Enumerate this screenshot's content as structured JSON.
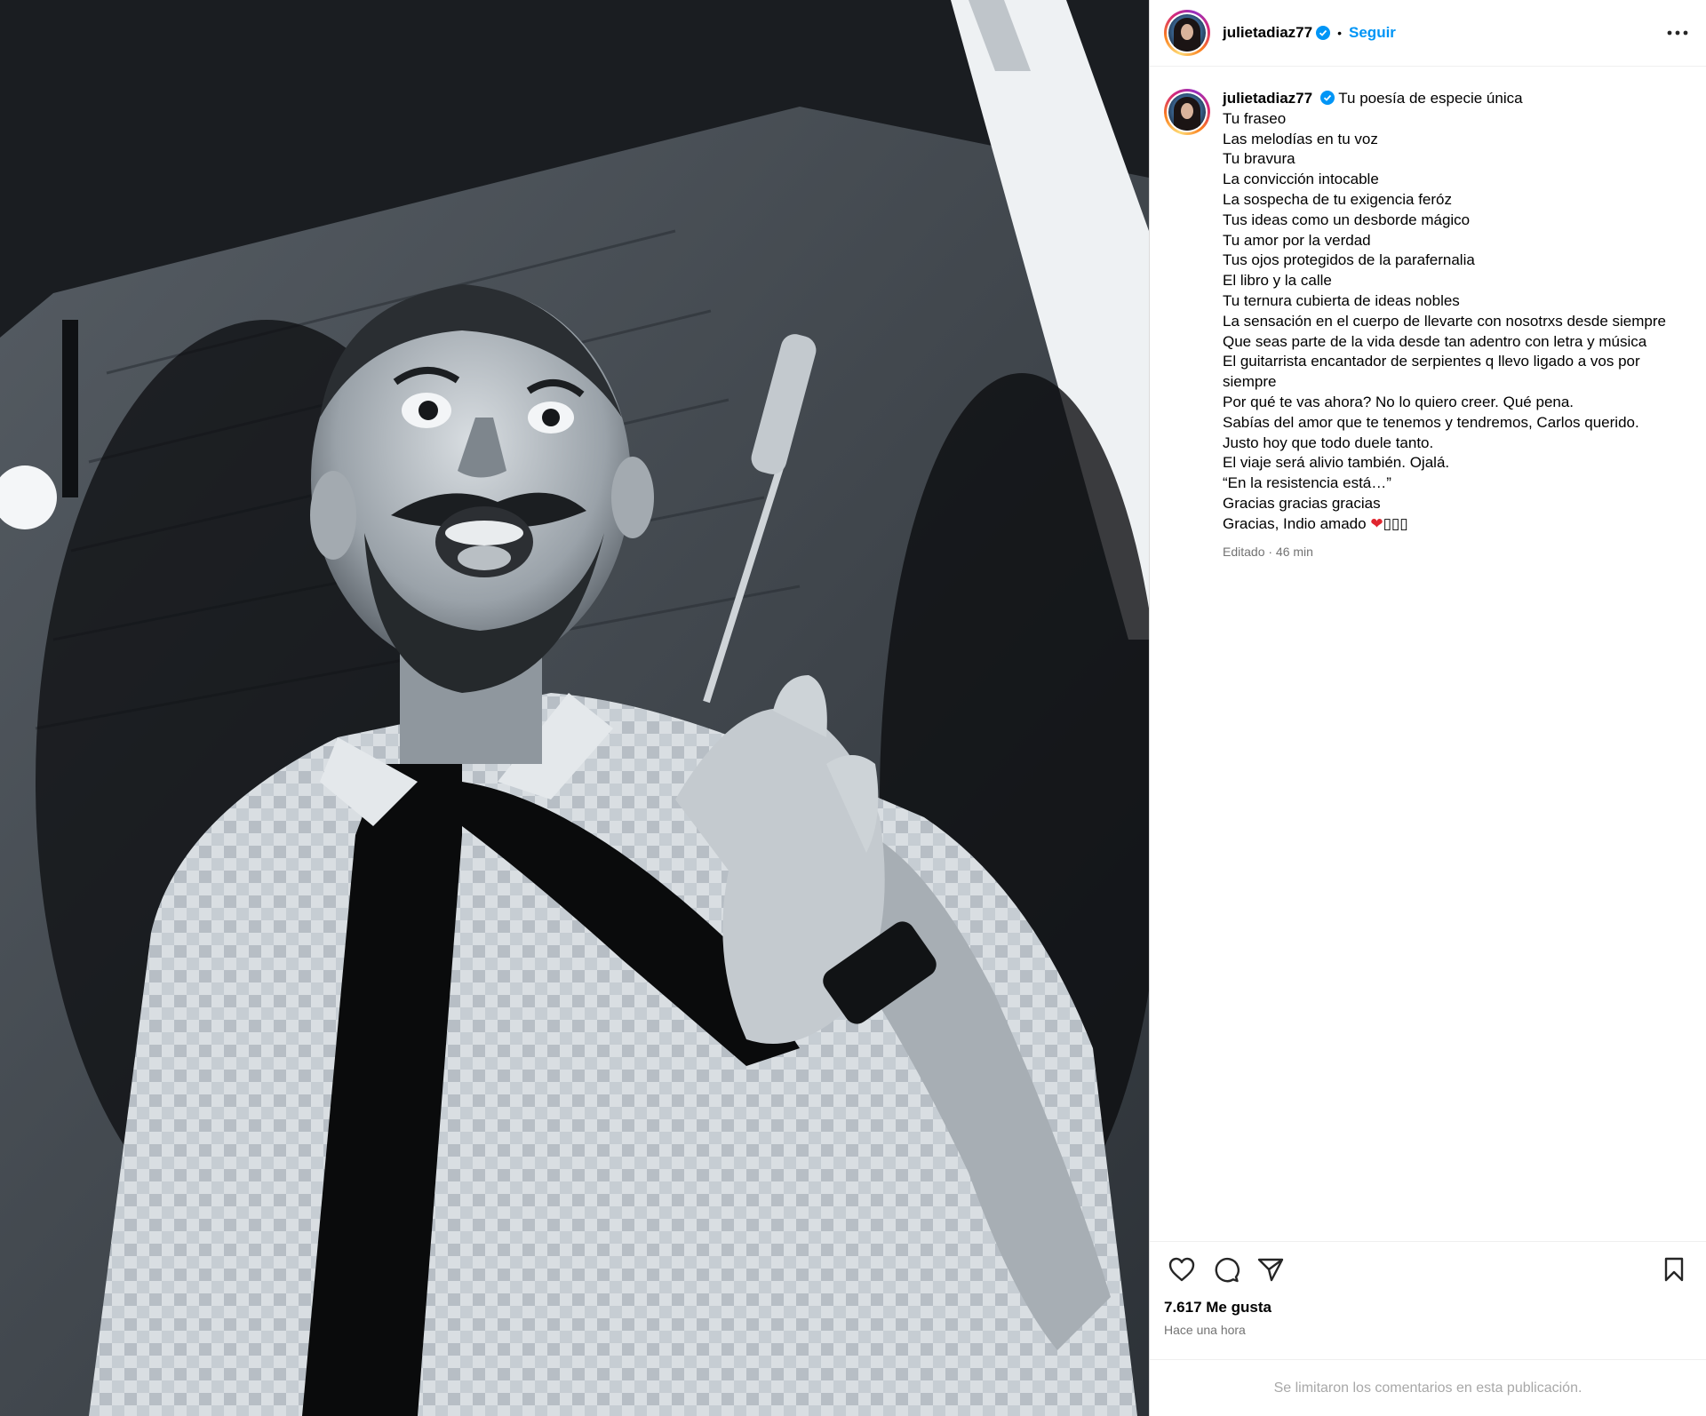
{
  "post": {
    "username": "julietadiaz77",
    "follow_label": "Seguir",
    "separator": "•",
    "caption_first": "Tu poesía de especie única",
    "caption_lines": [
      "Tu fraseo",
      "Las melodías en tu voz",
      "Tu bravura",
      "La convicción intocable",
      "La sospecha de tu exigencia feróz",
      "Tus ideas como un desborde mágico",
      "Tu amor por la verdad",
      "Tus ojos protegidos de la parafernalia",
      "El libro y la calle",
      "Tu ternura cubierta de ideas nobles",
      "La sensación en el cuerpo de llevarte con nosotrxs desde siempre",
      "Que seas parte de la vida desde tan adentro con letra y música",
      "El guitarrista encantador de serpientes q llevo ligado a vos por siempre",
      "Por qué te vas ahora? No lo quiero creer. Qué pena.",
      "Sabías del amor que te tenemos y tendremos, Carlos querido.",
      "Justo hoy que todo duele tanto.",
      "El viaje será alivio también. Ojalá.",
      "“En la resistencia está…”",
      "Gracias gracias gracias"
    ],
    "caption_last": "Gracias, Indio amado",
    "caption_emoji": "❤",
    "caption_emoji_tail": "▯▯▯",
    "edited_meta": "Editado · 46 min",
    "likes": "7.617 Me gusta",
    "time_ago": "Hace una hora",
    "comments_notice": "Se limitaron los comentarios en esta publicación."
  },
  "icons": {
    "more": "more-options-icon",
    "like": "heart-icon",
    "comment": "comment-icon",
    "share": "send-icon",
    "save": "bookmark-icon",
    "verified": "verified-badge-icon"
  },
  "colors": {
    "link_blue": "#0095f6",
    "muted_text": "#737373",
    "heart_red": "#e0252e",
    "verified_blue": "#0095f6"
  }
}
